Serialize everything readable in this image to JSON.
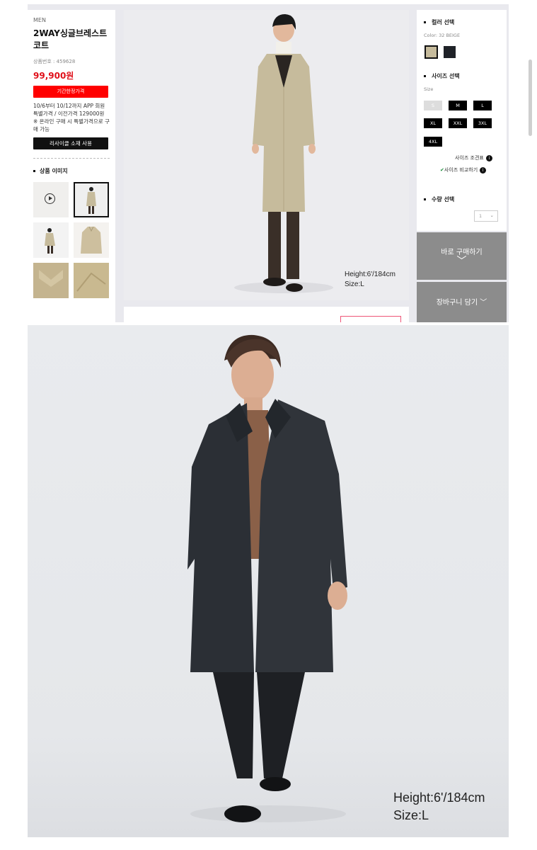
{
  "product": {
    "category": "MEN",
    "title": "2WAY싱글브레스트\n코트",
    "number": "상품번호 : 459628",
    "price": "99,900원",
    "promo_button": "기간한정가격",
    "promo_note": "10/6부터 10/12까지 APP 회원 특별가격 / 이전가격 129000원\n※ 온라인 구매 시 특별가격으로 구매 가능",
    "reuse_button": "리사이클 소재 사용",
    "images_heading": "상품 이미지"
  },
  "main_image": {
    "caption_height": "Height:6'/184cm",
    "caption_size": "Size:L"
  },
  "options": {
    "color_heading": "컬러 선택",
    "color_value": "Color: 32 BEIGE",
    "colors": [
      {
        "name": "beige",
        "hex": "#c6bb9c"
      },
      {
        "name": "navy",
        "hex": "#1f2228"
      }
    ],
    "size_heading": "사이즈 선택",
    "size_label": "Size",
    "sizes": [
      "S",
      "M",
      "L",
      "XL",
      "XXL",
      "3XL",
      "4XL"
    ],
    "size_chart_link": "사이즈 조견표",
    "size_compare_link": "사이즈 비교하기",
    "qty_heading": "수량 선택",
    "qty_value": "1",
    "buy_now": "바로 구매하기",
    "add_cart": "장바구니 담기"
  },
  "big_image": {
    "caption_height": "Height:6'/184cm",
    "caption_size": "Size:L"
  },
  "colors": {
    "accent_red": "#ff0000",
    "price_red": "#e0101a",
    "button_gray": "#8c8c8c"
  }
}
